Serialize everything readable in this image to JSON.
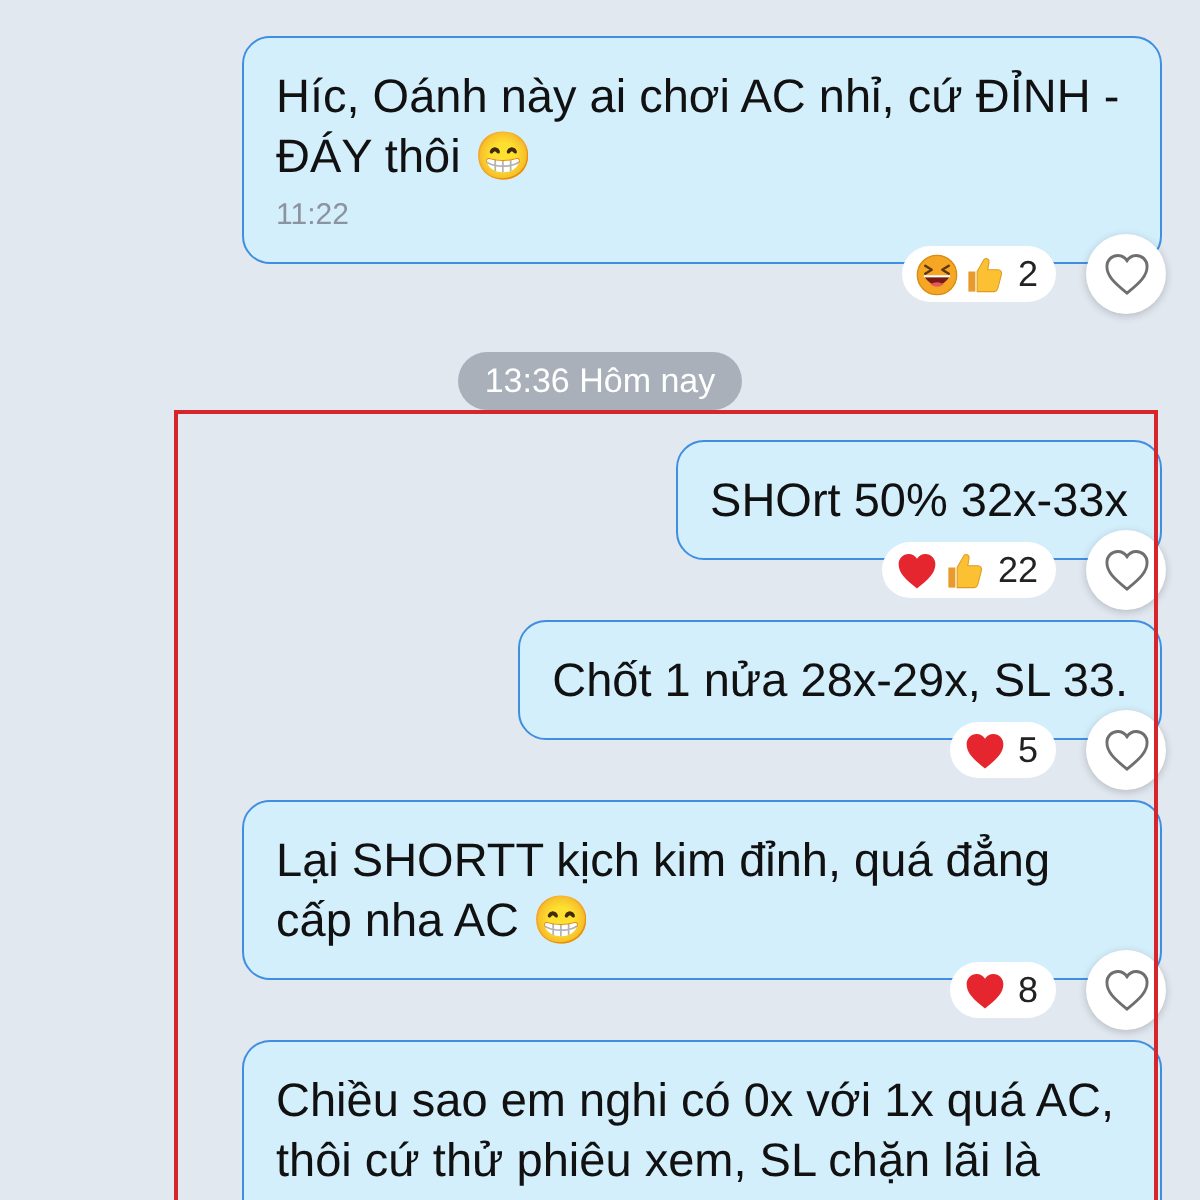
{
  "conversation": [
    {
      "kind": "message",
      "highlighted": false,
      "text": "Híc, Oánh này ai chơi AC nhỉ, cứ ĐỈNH - ĐÁY thôi 😁",
      "time": "11:22",
      "reactions": {
        "items": [
          {
            "kind": "laugh"
          },
          {
            "kind": "thumbs_up"
          }
        ],
        "count": "2"
      },
      "liked": false
    },
    {
      "kind": "divider",
      "highlighted": false,
      "text": "13:36 Hôm nay"
    },
    {
      "kind": "message",
      "highlighted": true,
      "text": "SHOrt 50% 32x-33x",
      "reactions": {
        "items": [
          {
            "kind": "heart"
          },
          {
            "kind": "thumbs_up"
          }
        ],
        "count": "22"
      },
      "liked": false
    },
    {
      "kind": "message",
      "highlighted": true,
      "text": "Chốt 1 nửa 28x-29x, SL 33.",
      "reactions": {
        "items": [
          {
            "kind": "heart"
          }
        ],
        "count": "5"
      },
      "liked": false
    },
    {
      "kind": "message",
      "highlighted": true,
      "text": "Lại SHORTT kịch kim đỉnh, quá đẳng cấp nha AC 😁",
      "reactions": {
        "items": [
          {
            "kind": "heart"
          }
        ],
        "count": "8"
      },
      "liked": false
    },
    {
      "kind": "message",
      "highlighted": true,
      "text": "Chiều sao em nghi có 0x với 1x quá AC, thôi cứ thử phiêu xem, SL chặn lãi là"
    }
  ]
}
